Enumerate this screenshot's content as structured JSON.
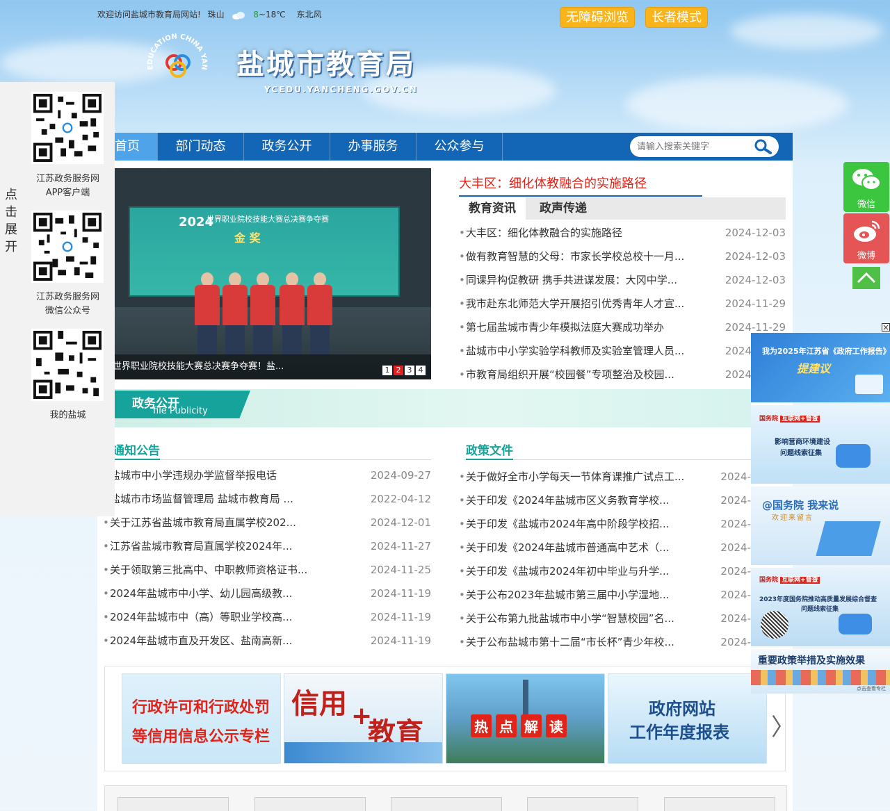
{
  "topbar": {
    "welcome": "欢迎访问盐城市教育局网站!",
    "city": "珠山",
    "temp_low": "8",
    "temp_high": "~18℃",
    "wind": "东北风",
    "accessible_btn": "无障碍浏览",
    "elder_btn": "长者模式"
  },
  "header": {
    "site_title": "盐城市教育局",
    "site_domain": "YCEDU.YANCHENG.GOV.CN",
    "logo_text": "EDUCATION CHINA YANCHENG"
  },
  "nav": {
    "items": [
      "首页",
      "部门动态",
      "政务公开",
      "办事服务",
      "公众参与"
    ],
    "search_placeholder": "请输入搜索关键字"
  },
  "slider": {
    "caption": "世界职业院校技能大赛总决赛争夺赛！盐...",
    "screen_year": "2024",
    "screen_line1": "世界职业院校技能大赛总决赛争夺赛",
    "screen_line2": "金 奖",
    "pages": [
      "1",
      "2",
      "3",
      "4"
    ],
    "active_page": 2
  },
  "news": {
    "headline": "大丰区：细化体教融合的实施路径",
    "tabs": [
      "教育资讯",
      "政声传递"
    ],
    "items": [
      {
        "title": "大丰区：细化体教融合的实施路径",
        "date": "2024-12-03"
      },
      {
        "title": "做有教育智慧的父母：市家长学校总校十一月...",
        "date": "2024-12-03"
      },
      {
        "title": "同课异构促教研 携手共进谋发展：大冈中学...",
        "date": "2024-12-03"
      },
      {
        "title": "我市赴东北师范大学开展招引优秀青年人才宣...",
        "date": "2024-11-29"
      },
      {
        "title": "第七届盐城市青少年模拟法庭大赛成功举办",
        "date": "2024-11-29"
      },
      {
        "title": "盐城市中小学实验学科教师及实验室管理人员...",
        "date": "2024-11-28"
      },
      {
        "title": "市教育局组织开展“校园餐”专项整治及校园...",
        "date": "2024-11-28"
      }
    ]
  },
  "gov": {
    "title_cn": "政务公开",
    "title_en": "file Publicity"
  },
  "notices": {
    "title": "通知公告",
    "items": [
      {
        "title": "盐城市中小学违规办学监督举报电话",
        "date": "2024-09-27"
      },
      {
        "title": "盐城市市场监督管理局 盐城市教育局 ...",
        "date": "2022-04-12"
      },
      {
        "title": "关于江苏省盐城市教育局直属学校202...",
        "date": "2024-12-01"
      },
      {
        "title": "江苏省盐城市教育局直属学校2024年...",
        "date": "2024-11-27"
      },
      {
        "title": "关于领取第三批高中、中职教师资格证书...",
        "date": "2024-11-25"
      },
      {
        "title": "2024年盐城市中小学、幼儿园高级教...",
        "date": "2024-11-19"
      },
      {
        "title": "2024年盐城市中（高）等职业学校高...",
        "date": "2024-11-19"
      },
      {
        "title": "2024年盐城市直及开发区、盐南高新...",
        "date": "2024-11-19"
      }
    ]
  },
  "policies": {
    "title": "政策文件",
    "items": [
      {
        "title": "关于做好全市小学每天一节体育课推广试点工...",
        "date": "2024-"
      },
      {
        "title": "关于印发《2024年盐城市区义务教育学校...",
        "date": "2024-"
      },
      {
        "title": "关于印发《盐城市2024年高中阶段学校招...",
        "date": "2024-"
      },
      {
        "title": "关于印发《2024年盐城市普通高中艺术（...",
        "date": "2024-"
      },
      {
        "title": "关于印发《盐城市2024年初中毕业与升学...",
        "date": "2024-"
      },
      {
        "title": "关于公布2023年盐城市第三届中小学湿地...",
        "date": "2024-"
      },
      {
        "title": "关于公布第九批盐城市中小学“智慧校园”名...",
        "date": "2024-"
      },
      {
        "title": "关于公布盐城市第十二届“市长杯”青少年校...",
        "date": "2024-"
      }
    ]
  },
  "banners": {
    "b1_line1": "行政许可和行政处罚",
    "b1_line2": "等信用信息公示专栏",
    "b2_a": "信用",
    "b2_b": "教育",
    "b3": [
      "热",
      "点",
      "解",
      "读"
    ],
    "b4_line1": "政府网站",
    "b4_line2": "工作年度报表",
    "prev": "〈",
    "next": "〉"
  },
  "leftpanel": {
    "expand": [
      "点",
      "击",
      "展",
      "开"
    ],
    "qr1_caption_1": "江苏政务服务网",
    "qr1_caption_2": "APP客户端",
    "qr2_caption_1": "江苏政务服务网",
    "qr2_caption_2": "微信公众号",
    "qr3_caption": "我的盐城"
  },
  "rightbar": {
    "wechat": "微信",
    "weibo": "微博"
  },
  "ads": {
    "close": "×",
    "ad1_line1": "我为2025年江苏省《政府工作报告》",
    "ad1_line2": "提建议",
    "ad2_tag": "国务院",
    "ad2_tag2": "互联网+督查",
    "ad2_line1": "影响营商环境建设",
    "ad2_line2": "问题线索征集",
    "ad3_line1": "@国务院 我来说",
    "ad3_line2": "欢迎来留言",
    "ad4_tag": "国务院",
    "ad4_tag2": "互联网+督查",
    "ad4_line1": "2023年度国务院推动高质量发展综合督查",
    "ad4_line2": "问题线索征集",
    "ad5_line1": "重要政策举措及实施效果",
    "ad5_line2": "点击查看专栏"
  },
  "colors": {
    "nav_blue": "#1366b5",
    "nav_active": "#4fa3e8",
    "teal": "#15a39b",
    "headline_red": "#e0241a",
    "button_yellow": "#f8b41a",
    "wechat_green": "#3cc640",
    "weibo_red": "#e65555"
  }
}
